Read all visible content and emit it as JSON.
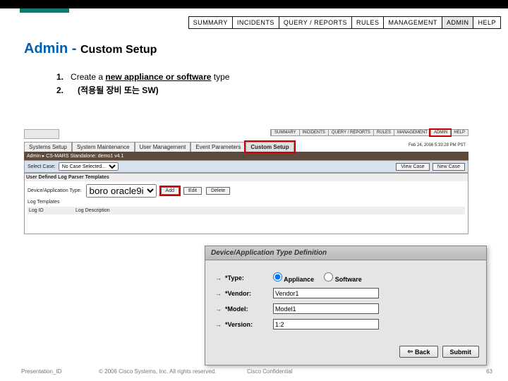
{
  "nav": [
    "SUMMARY",
    "INCIDENTS",
    "QUERY / REPORTS",
    "RULES",
    "MANAGEMENT",
    "ADMIN",
    "HELP"
  ],
  "title": {
    "blue": "Admin - ",
    "black": "Custom Setup"
  },
  "list": {
    "n1": "1.",
    "t1a": "Create a ",
    "t1b": "new appliance or software",
    "t1c": " type",
    "n2": "2.",
    "t2": "(적용될 장비 또는 SW)"
  },
  "shot": {
    "tabs": [
      "Systems Setup",
      "System Maintenance",
      "User Management",
      "Event Parameters",
      "Custom Setup"
    ],
    "breadcrumb": "Admin ▸ CS-MARS Standalone: demo1 v4.1",
    "selectCaseLabel": "Select Case:",
    "selectCaseValue": "No Case Selected...",
    "viewBtn": "View Case",
    "newBtn": "New Case",
    "panelTitle": "User Defined Log Parser Templates",
    "rowLabel": "Device/Application Type:",
    "rowValue": "boro oracle9i",
    "addBtn": "Add",
    "editBtn": "Edit",
    "delBtn": "Delete",
    "row2": "Log Templates",
    "th1": "Log ID",
    "th2": "Log Description",
    "nav2": [
      "SUMMARY",
      "INCIDENTS",
      "QUERY / REPORTS",
      "RULES",
      "MANAGEMENT",
      "ADMIN",
      "HELP"
    ],
    "date": "Feb 24, 2006 5:33:28 PM PST"
  },
  "dialog": {
    "title": "Device/Application Type Definition",
    "typeLabel": "*Type:",
    "r1": "Appliance",
    "r2": "Software",
    "vendorLabel": "*Vendor:",
    "vendorVal": "Vendor1",
    "modelLabel": "*Model:",
    "modelVal": "Model1",
    "versionLabel": "*Version:",
    "versionVal": "1:2",
    "back": "Back",
    "submit": "Submit"
  },
  "footer": {
    "left": "Presentation_ID",
    "mid": "© 2006 Cisco Systems, Inc. All rights reserved.",
    "mid2": "Cisco Confidential",
    "right": "63"
  }
}
